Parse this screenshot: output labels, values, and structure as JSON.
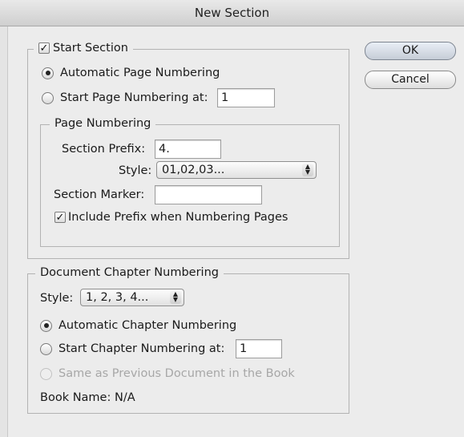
{
  "window": {
    "title": "New Section"
  },
  "buttons": {
    "ok": "OK",
    "cancel": "Cancel"
  },
  "start_section": {
    "label": "Start Section",
    "checked": true,
    "auto_page_numbering": "Automatic Page Numbering",
    "auto_selected": true,
    "start_page_numbering_at": "Start Page Numbering at:",
    "start_page_value": "1"
  },
  "page_numbering": {
    "legend": "Page Numbering",
    "section_prefix_label": "Section Prefix:",
    "section_prefix_value": "4.",
    "style_label": "Style:",
    "style_value": "01,02,03...",
    "section_marker_label": "Section Marker:",
    "section_marker_value": "",
    "include_prefix_label": "Include Prefix when Numbering Pages",
    "include_prefix_checked": true
  },
  "chapter_numbering": {
    "legend": "Document Chapter Numbering",
    "style_label": "Style:",
    "style_value": "1, 2, 3, 4...",
    "auto_chapter_numbering": "Automatic Chapter Numbering",
    "auto_selected": true,
    "start_chapter_numbering_at": "Start Chapter Numbering at:",
    "start_chapter_value": "1",
    "same_as_previous": "Same as Previous Document in the Book",
    "book_name": "Book Name: N/A"
  },
  "icons": {
    "check": "checkmark-icon",
    "stepper": "up-down-arrows-icon"
  }
}
